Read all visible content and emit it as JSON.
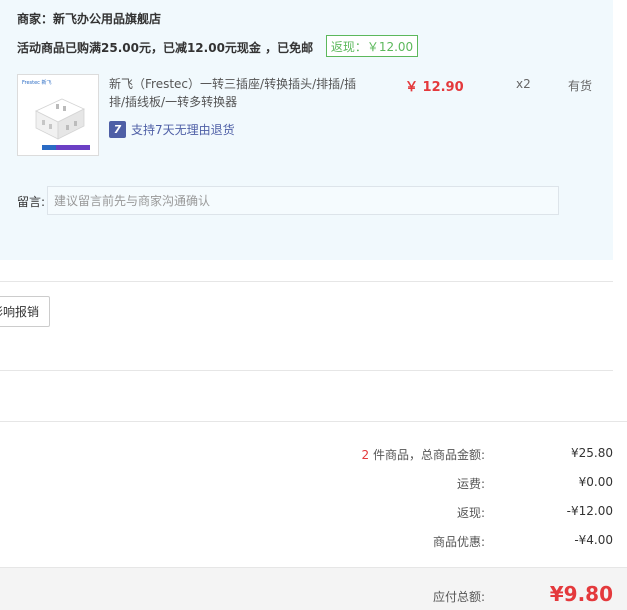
{
  "store": {
    "merchant_label": "商家：",
    "merchant_name": "新飞办公用品旗舰店",
    "promo_text": "活动商品已购满25.00元，已减12.00元现金 ，已免邮",
    "rebate_badge": "返现：￥12.00"
  },
  "product": {
    "name": "新飞（Frestec）一转三插座/转换插头/排插/插排/插线板/一转多转换器",
    "return_icon_char": "7",
    "return_policy": "支持7天无理由退货",
    "price": "￥ 12.90",
    "quantity": "x2",
    "stock": "有货",
    "thumbnail_brand": "Frestec 新飞"
  },
  "note": {
    "label": "留言:",
    "placeholder": "建议留言前先与商家沟通确认"
  },
  "invoice": {
    "button_label": "影响报销"
  },
  "summary": {
    "count": "2",
    "count_suffix": " 件商品，总商品金额:",
    "subtotal": "¥25.80",
    "shipping_label": "运费:",
    "shipping": "¥0.00",
    "rebate_label": "返现:",
    "rebate": "-¥12.00",
    "discount_label": "商品优惠:",
    "discount": "-¥4.00",
    "total_label": "应付总额:",
    "total": "¥9.80"
  },
  "colors": {
    "panel_bg": "#f1f9fd",
    "price_red": "#e4393c",
    "rebate_green": "#5cb85c",
    "link_blue": "#4e5fa6"
  }
}
